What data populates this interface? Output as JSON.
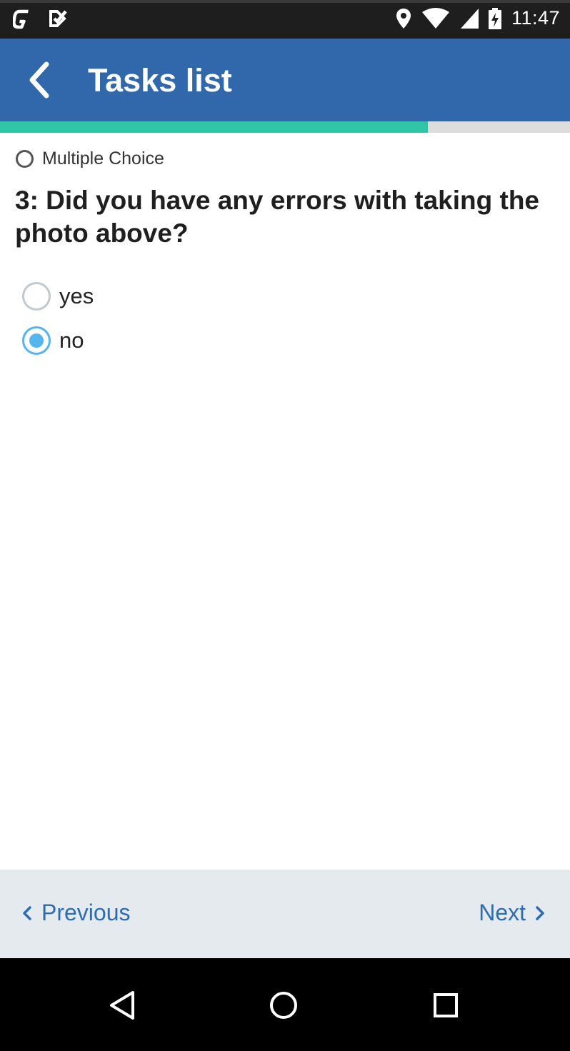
{
  "status_bar": {
    "time": "11:47",
    "left_icons": [
      "g-notification-icon",
      "check-notification-icon"
    ],
    "right_icons": [
      "location-icon",
      "wifi-icon",
      "signal-icon",
      "battery-charging-icon"
    ]
  },
  "app_bar": {
    "title": "Tasks list",
    "back_icon": "chevron-left-icon",
    "color": "#3068ab"
  },
  "progress": {
    "fraction": 0.75,
    "fill_color": "#2fc5a7",
    "track_color": "#dddddd"
  },
  "question": {
    "type_label": "Multiple Choice",
    "text": "3: Did you have any errors with taking the photo above?",
    "options": [
      {
        "label": "yes",
        "selected": false
      },
      {
        "label": "no",
        "selected": true
      }
    ],
    "selected_color": "#55b5ee"
  },
  "footer": {
    "previous_label": "Previous",
    "next_label": "Next",
    "link_color": "#2e6cb0"
  },
  "system_nav": {
    "icons": [
      "back-triangle-icon",
      "home-circle-icon",
      "recents-square-icon"
    ]
  }
}
